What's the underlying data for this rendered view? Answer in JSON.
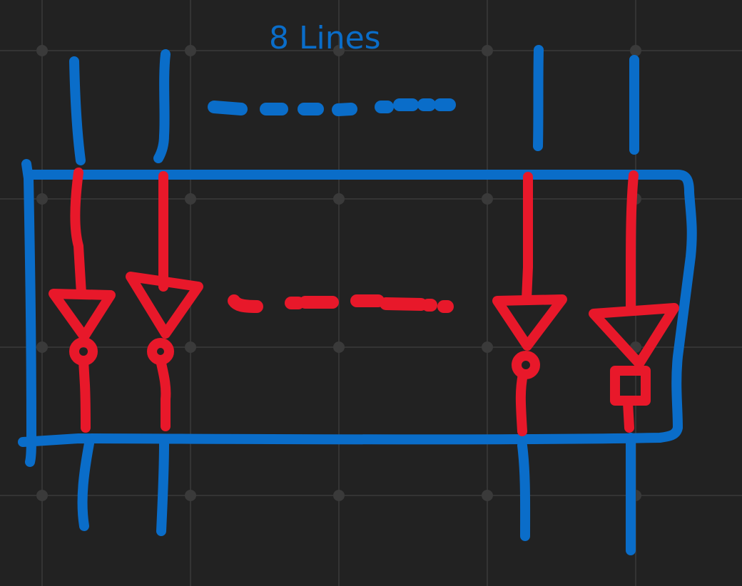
{
  "diagram": {
    "label": "8 Lines",
    "colors": {
      "background": "#222222",
      "grid": "#343434",
      "grid_dot": "#3a3a3a",
      "bus": "#0a6dc9",
      "inverter": "#e8182a"
    },
    "inverter_count_drawn": 4,
    "icons": [
      "inverter-icon",
      "bus-line-icon",
      "ellipsis-dashes-icon"
    ]
  }
}
